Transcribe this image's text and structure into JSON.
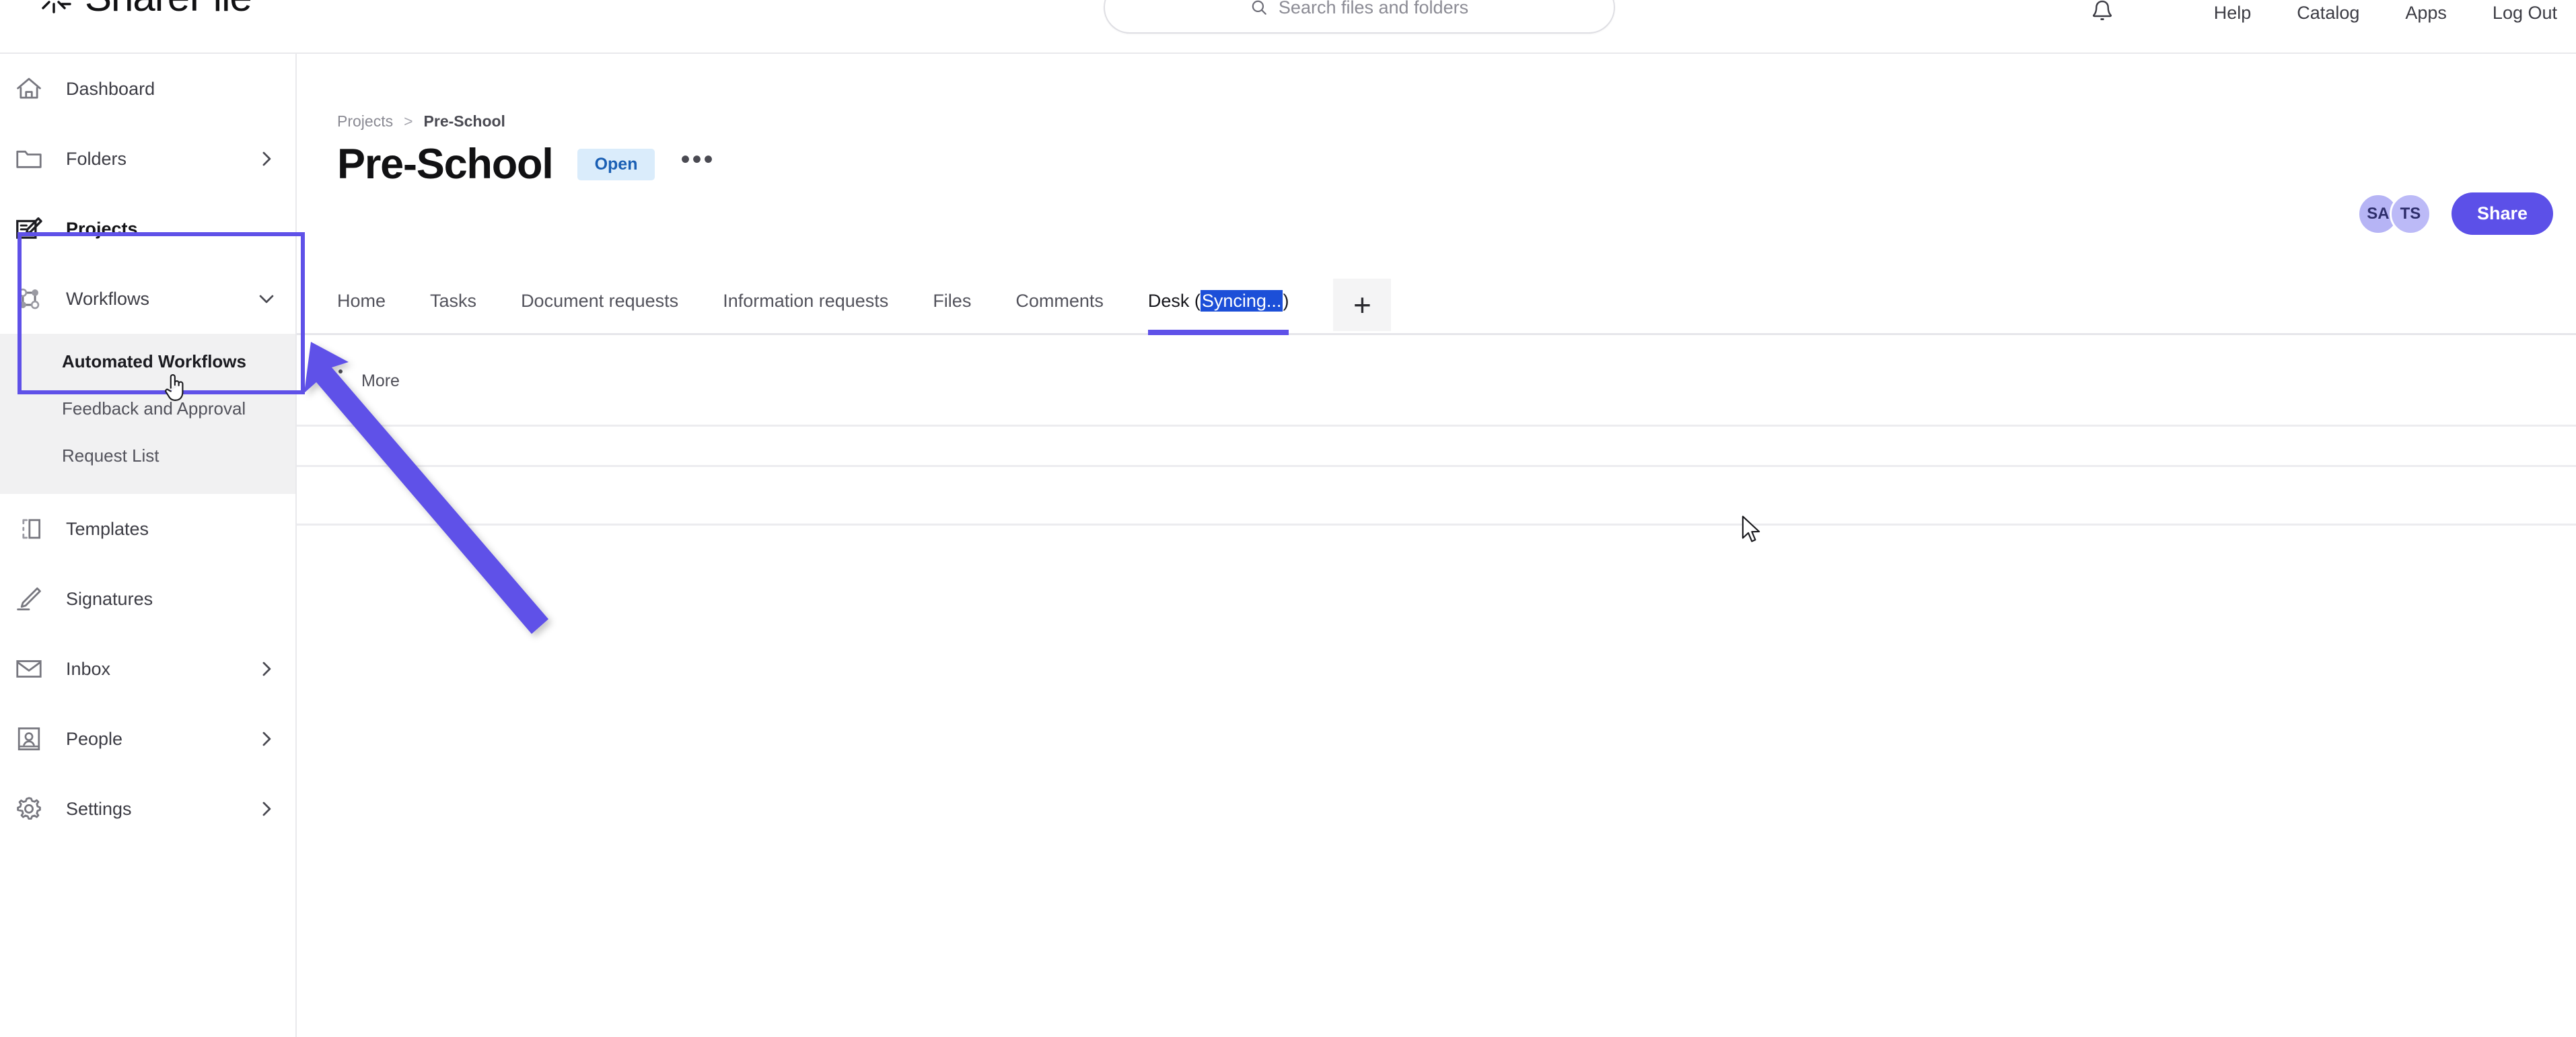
{
  "header": {
    "brand_name": "ShareFile",
    "brand_icon": "sharefile-logo-icon",
    "search": {
      "icon": "search-icon",
      "placeholder": "Search files and folders",
      "value": ""
    },
    "notification_icon": "bell-icon",
    "links": [
      "Help",
      "Catalog",
      "Apps",
      "Log Out"
    ]
  },
  "sidebar": {
    "items": [
      {
        "label": "Dashboard",
        "icon": "home-icon",
        "chevron": "none",
        "active": false
      },
      {
        "label": "Folders",
        "icon": "folder-icon",
        "chevron": "right",
        "active": false
      },
      {
        "label": "Projects",
        "icon": "projects-edit-icon",
        "chevron": "none",
        "active": true
      },
      {
        "label": "Workflows",
        "icon": "workflows-nodes-icon",
        "chevron": "down",
        "active": false
      },
      {
        "label": "Templates",
        "icon": "template-icon",
        "chevron": "none",
        "active": false
      },
      {
        "label": "Signatures",
        "icon": "signature-pen-icon",
        "chevron": "none",
        "active": false
      },
      {
        "label": "Inbox",
        "icon": "envelope-icon",
        "chevron": "right",
        "active": false
      },
      {
        "label": "People",
        "icon": "people-contact-icon",
        "chevron": "right",
        "active": false
      },
      {
        "label": "Settings",
        "icon": "gear-icon",
        "chevron": "right",
        "active": false
      }
    ],
    "workflows_submenu": [
      {
        "label": "Automated Workflows",
        "active": true
      },
      {
        "label": "Feedback and Approval",
        "active": false
      },
      {
        "label": "Request List",
        "active": false
      }
    ]
  },
  "main": {
    "breadcrumb": {
      "parent": "Projects",
      "separator": ">",
      "current": "Pre-School"
    },
    "title": "Pre-School",
    "status_badge": "Open",
    "overflow_menu_icon": "ellipsis-icon",
    "avatars": [
      "SA",
      "TS"
    ],
    "share_label": "Share",
    "tabs": [
      {
        "label": "Home",
        "active": false
      },
      {
        "label": "Tasks",
        "active": false
      },
      {
        "label": "Document requests",
        "active": false
      },
      {
        "label": "Information requests",
        "active": false
      },
      {
        "label": "Files",
        "active": false
      },
      {
        "label": "Comments",
        "active": false
      }
    ],
    "active_tab": {
      "prefix": "Desk (",
      "selected": "Syncing...",
      "suffix": ")"
    },
    "add_tab_label": "+",
    "more_row": {
      "icon": "vertical-dots-icon",
      "label": "More"
    }
  },
  "annotations": {
    "highlight_color": "#5f51e8",
    "arrow_color": "#5f51e8",
    "cursor_icon": "arrow-cursor",
    "hand_cursor_icon": "hand-pointer-cursor"
  },
  "colors": {
    "accent_purple": "#5c50e8",
    "badge_bg": "#daecfb",
    "badge_text": "#1a5fb4",
    "avatar_bg": "#b6b4f5",
    "selection_blue": "#1c4fd8",
    "border_gray": "#e9e9ec"
  }
}
